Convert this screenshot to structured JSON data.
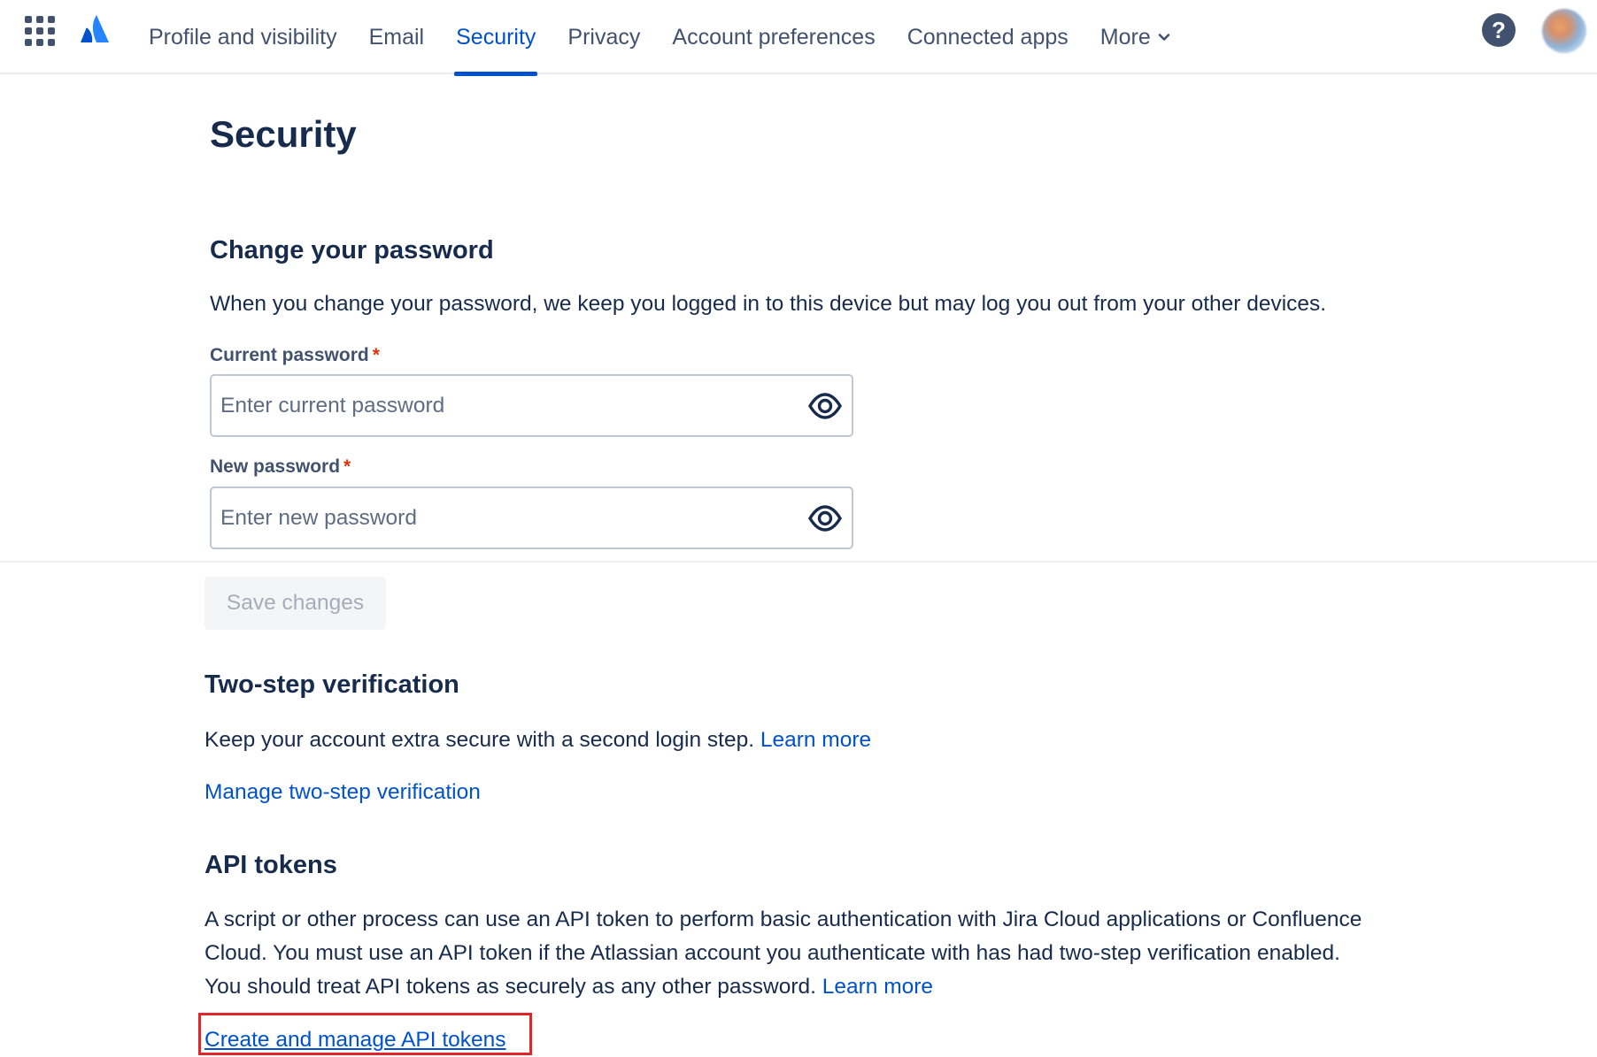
{
  "nav": {
    "tabs": [
      {
        "label": "Profile and visibility"
      },
      {
        "label": "Email"
      },
      {
        "label": "Security"
      },
      {
        "label": "Privacy"
      },
      {
        "label": "Account preferences"
      },
      {
        "label": "Connected apps"
      },
      {
        "label": "More"
      }
    ],
    "active_tab": "Security",
    "help_label": "?",
    "accent_color": "#0052cc"
  },
  "page": {
    "title": "Security"
  },
  "password": {
    "heading": "Change your password",
    "description": "When you change your password, we keep you logged in to this device but may log you out from your other devices.",
    "current_label": "Current password",
    "current_placeholder": "Enter current password",
    "new_label": "New password",
    "new_placeholder": "Enter new password",
    "required_marker": "*",
    "save_label": "Save changes"
  },
  "two_step": {
    "heading": "Two-step verification",
    "description": "Keep your account extra secure with a second login step.",
    "learn_more": "Learn more",
    "manage_link": "Manage two-step verification"
  },
  "api_tokens": {
    "heading": "API tokens",
    "description": "A script or other process can use an API token to perform basic authentication with Jira Cloud applications or Confluence Cloud. You must use an API token if the Atlassian account you authenticate with has had two-step verification enabled. You should treat API tokens as securely as any other password.",
    "learn_more": "Learn more",
    "manage_link": "Create and manage API tokens"
  },
  "icons": [
    "app-switcher-icon",
    "atlassian-logo-icon",
    "chevron-down-icon",
    "help-icon",
    "eye-icon"
  ]
}
